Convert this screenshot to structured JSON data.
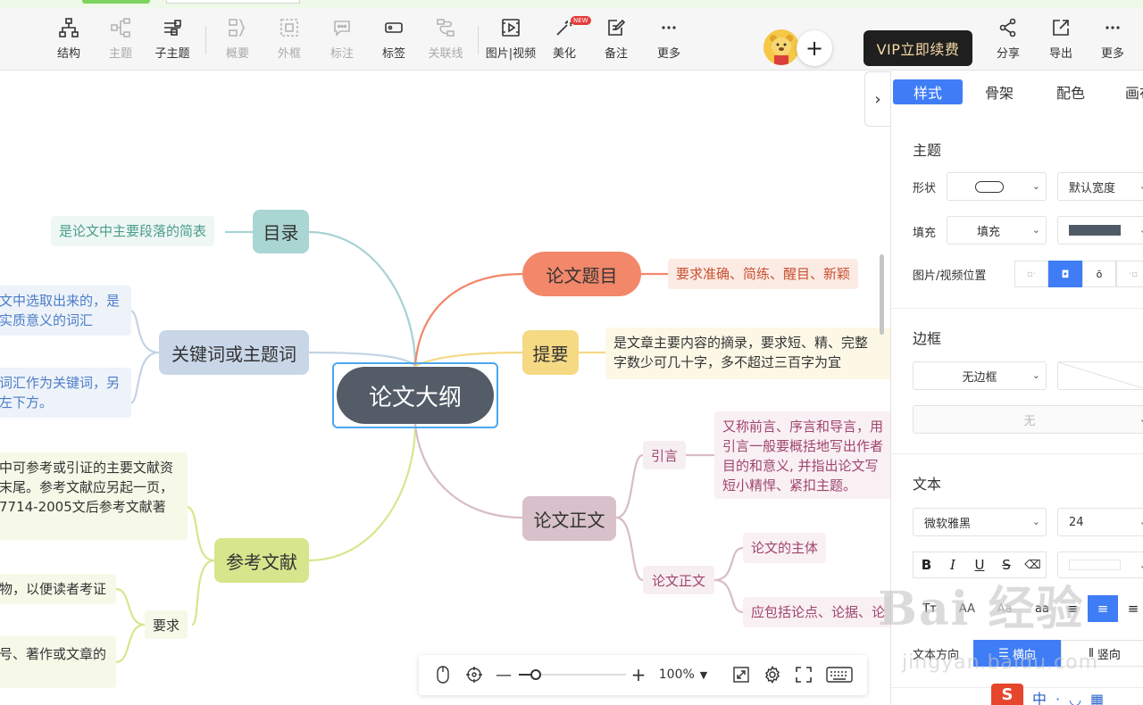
{
  "toolbar": {
    "items": [
      {
        "label": "结构",
        "icon": "structure-icon",
        "enabled": true
      },
      {
        "label": "主题",
        "icon": "topic-icon",
        "enabled": false
      },
      {
        "label": "子主题",
        "icon": "subtopic-icon",
        "enabled": true
      },
      {
        "label": "概要",
        "icon": "summary-icon",
        "enabled": false
      },
      {
        "label": "外框",
        "icon": "boundary-icon",
        "enabled": false
      },
      {
        "label": "标注",
        "icon": "callout-icon",
        "enabled": false
      },
      {
        "label": "标签",
        "icon": "tag-icon",
        "enabled": true
      },
      {
        "label": "关联线",
        "icon": "relation-line-icon",
        "enabled": false
      },
      {
        "label": "图片|视频",
        "icon": "media-icon",
        "enabled": true
      },
      {
        "label": "美化",
        "icon": "magic-wand-icon",
        "enabled": true,
        "badge": "NEW"
      },
      {
        "label": "备注",
        "icon": "note-icon",
        "enabled": true
      },
      {
        "label": "更多",
        "icon": "more-icon",
        "enabled": true
      }
    ],
    "vip_label": "VIP立即续费",
    "share_label": "分享",
    "export_label": "导出",
    "more_label": "更多"
  },
  "mindmap": {
    "root": "论文大纲",
    "left": [
      {
        "title": "目录",
        "leaf": "是论文中主要段落的简表"
      },
      {
        "title": "关键词或主题词",
        "leaves": [
          "文中选取出来的，是\n实质意义的词汇",
          "词汇作为关键词，另\n左下方。"
        ]
      },
      {
        "title": "参考文献",
        "leaf": "中可参考或引证的主要文献资\n末尾。参考文献应另起一页，\n7714-2005文后参考文献著",
        "sub": "要求",
        "subleaves": [
          "物，以便读者考证",
          "号、著作或文章的"
        ]
      }
    ],
    "right": [
      {
        "title": "论文题目",
        "leaf": "要求准确、简练、醒目、新颖"
      },
      {
        "title": "提要",
        "leaf": "是文章主要内容的摘录，要求短、精、完整\n字数少可几十字，多不超过三百字为宜"
      },
      {
        "title": "论文正文",
        "children": [
          {
            "title": "引言",
            "leaf": "又称前言、序言和导言，用\n引言一般要概括地写出作者\n目的和意义, 并指出论文写\n短小精悍、紧扣主题。"
          },
          {
            "title": "论文正文",
            "leaves": [
              "论文的主体",
              "应包括论点、论据、论"
            ]
          }
        ]
      }
    ]
  },
  "zoom": {
    "value": "100%"
  },
  "panel": {
    "tabs": [
      "样式",
      "骨架",
      "配色",
      "画布"
    ],
    "active_tab": "样式",
    "theme_section": "主题",
    "shape_label": "形状",
    "width_value": "默认宽度",
    "fill_label": "填充",
    "fill_value": "填充",
    "fill_color": "#505a66",
    "media_pos_label": "图片/视频位置",
    "border_section": "边框",
    "border_value": "无边框",
    "border_style_value": "无",
    "text_section": "文本",
    "font_value": "微软雅黑",
    "size_value": "24",
    "text_dir_label": "文本方向",
    "horizontal_label": "横向",
    "vertical_label": "竖向",
    "accent": "#3f7df6"
  },
  "watermark": {
    "text": "Bai 经验",
    "sub": "jingyan.baidu.com"
  }
}
